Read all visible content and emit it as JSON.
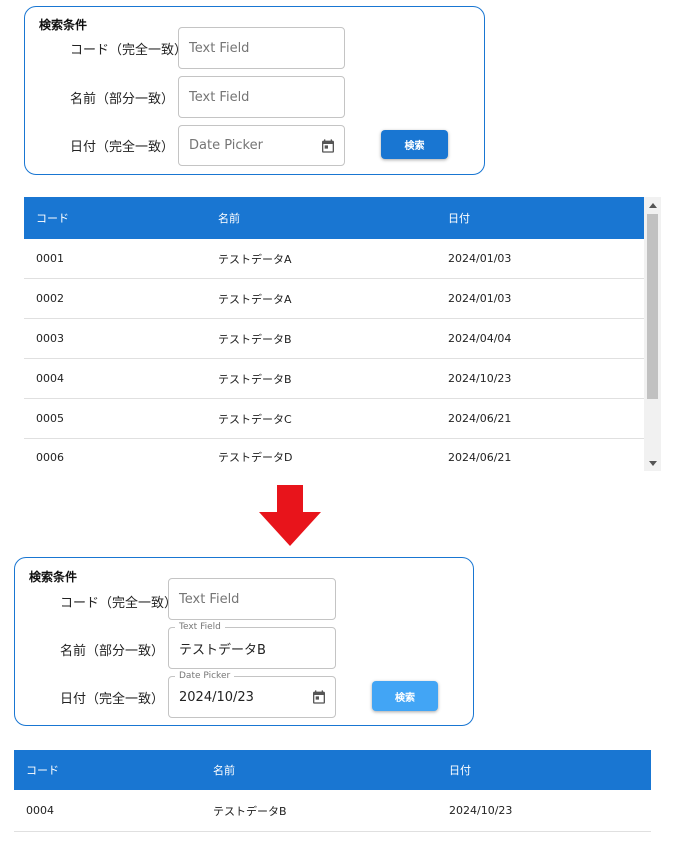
{
  "top": {
    "panel_title": "検索条件",
    "labels": {
      "code": "コード（完全一致）",
      "name": "名前（部分一致）",
      "date": "日付（完全一致）"
    },
    "code_field": {
      "placeholder": "Text Field"
    },
    "name_field": {
      "placeholder": "Text Field"
    },
    "date_field": {
      "placeholder": "Date Picker",
      "icon": "calendar-icon"
    },
    "search_button": "検索",
    "columns": [
      "コード",
      "名前",
      "日付"
    ],
    "rows": [
      [
        "0001",
        "テストデータA",
        "2024/01/03"
      ],
      [
        "0002",
        "テストデータA",
        "2024/01/03"
      ],
      [
        "0003",
        "テストデータB",
        "2024/04/04"
      ],
      [
        "0004",
        "テストデータB",
        "2024/10/23"
      ],
      [
        "0005",
        "テストデータC",
        "2024/06/21"
      ],
      [
        "0006",
        "テストデータD",
        "2024/06/21"
      ]
    ]
  },
  "arrow": {
    "color": "#e8141b"
  },
  "bottom": {
    "panel_title": "検索条件",
    "labels": {
      "code": "コード（完全一致）",
      "name": "名前（部分一致）",
      "date": "日付（完全一致）"
    },
    "code_field": {
      "placeholder": "Text Field"
    },
    "name_field": {
      "floating_label": "Text Field",
      "value": "テストデータB"
    },
    "date_field": {
      "floating_label": "Date Picker",
      "value": "2024/10/23",
      "icon": "calendar-icon"
    },
    "search_button": "検索",
    "columns": [
      "コード",
      "名前",
      "日付"
    ],
    "rows": [
      [
        "0004",
        "テストデータB",
        "2024/10/23"
      ]
    ]
  },
  "colors": {
    "primary": "#1976d2",
    "button_hover": "#42a5f5"
  }
}
